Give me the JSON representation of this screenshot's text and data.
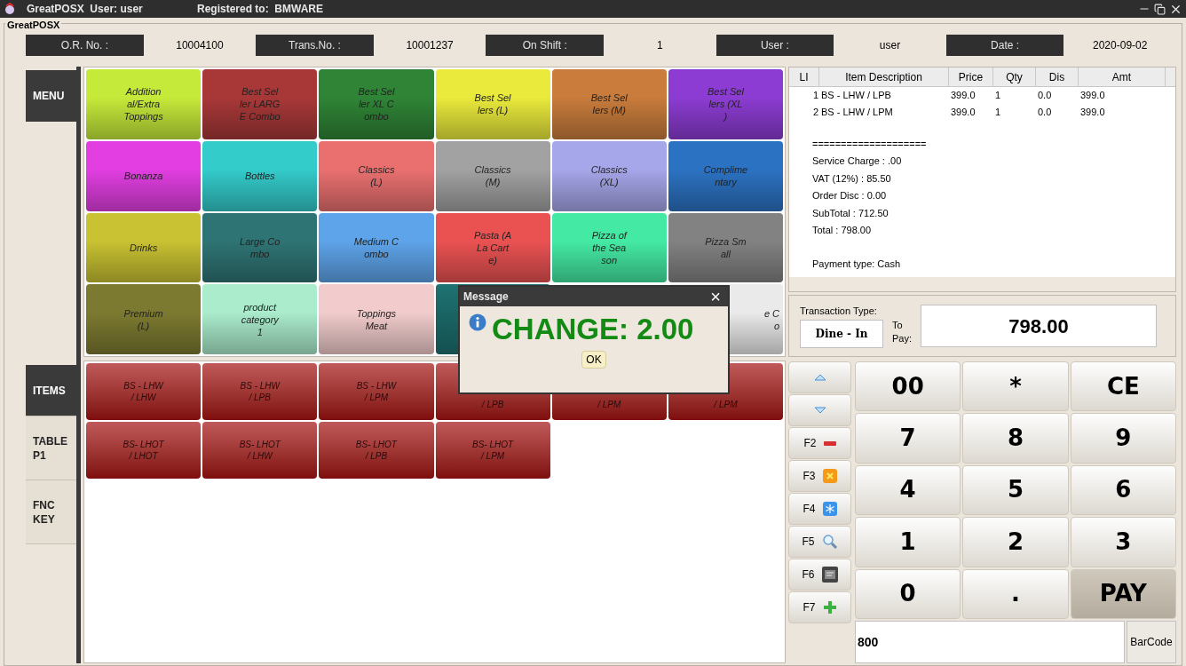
{
  "window": {
    "title": "GreatPOSX  User: user",
    "registered": "Registered to:  BMWARE",
    "group_label": "GreatPOSX"
  },
  "info_bar": [
    {
      "label": "O.R. No. :",
      "value": "10004100"
    },
    {
      "label": "Trans.No. :",
      "value": "10001237"
    },
    {
      "label": "On Shift :",
      "value": "1"
    },
    {
      "label": "User :",
      "value": "user"
    },
    {
      "label": "Date :",
      "value": "2020-09-02"
    }
  ],
  "menu_tab": {
    "label": "MENU",
    "selected": true
  },
  "item_tabs": [
    {
      "label": "ITEMS",
      "selected": true
    },
    {
      "label": "TABLE\nP1",
      "selected": false
    },
    {
      "label": "FNC\nKEY",
      "selected": false
    }
  ],
  "menu_tiles": [
    {
      "kind": "full",
      "color": "#c6ea3a",
      "lines": [
        "Addition",
        "al/Extra",
        "Toppings"
      ]
    },
    {
      "kind": "full",
      "color": "#a83838",
      "lines": [
        "Best Sel",
        "ler LARG",
        "E Combo"
      ]
    },
    {
      "kind": "full",
      "color": "#2f8436",
      "lines": [
        "Best Sel",
        "ler XL C",
        "ombo"
      ]
    },
    {
      "kind": "full",
      "color": "#eaea3c",
      "lines": [
        "Best Sel",
        "lers (L)"
      ]
    },
    {
      "kind": "full",
      "color": "#c97c3c",
      "lines": [
        "Best Sel",
        "lers (M)"
      ]
    },
    {
      "kind": "full",
      "color": "#8c3cd2",
      "lines": [
        "Best Sel",
        "lers (XL",
        ")"
      ]
    },
    {
      "kind": "full",
      "color": "#e23ee2",
      "lines": [
        "Bonanza"
      ]
    },
    {
      "kind": "full",
      "color": "#34cbcb",
      "lines": [
        "Bottles"
      ]
    },
    {
      "kind": "full",
      "color": "#ea7070",
      "lines": [
        "Classics",
        "(L)"
      ]
    },
    {
      "kind": "full",
      "color": "#a2a2a2",
      "lines": [
        "Classics",
        "(M)"
      ]
    },
    {
      "kind": "full",
      "color": "#a6a6ea",
      "lines": [
        "Classics",
        "(XL)"
      ]
    },
    {
      "kind": "full",
      "color": "#2c72c2",
      "lines": [
        "Complime",
        "ntary"
      ]
    },
    {
      "kind": "full",
      "color": "#c9c232",
      "lines": [
        "Drinks"
      ]
    },
    {
      "kind": "full",
      "color": "#2f7474",
      "lines": [
        "Large Co",
        "mbo"
      ]
    },
    {
      "kind": "full",
      "color": "#5ea4ea",
      "lines": [
        "Medium C",
        "ombo"
      ]
    },
    {
      "kind": "full",
      "color": "#ea5252",
      "lines": [
        "Pasta (A",
        "La Cart",
        "e)"
      ]
    },
    {
      "kind": "full",
      "color": "#44eaa4",
      "lines": [
        "Pizza of",
        "the Sea",
        "son"
      ]
    },
    {
      "kind": "full",
      "color": "#828282",
      "lines": [
        "Pizza Sm",
        "all"
      ]
    },
    {
      "kind": "full",
      "color": "#7c7a30",
      "lines": [
        "Premium",
        "(L)"
      ]
    },
    {
      "kind": "full",
      "color": "#aaeccc",
      "lines": [
        "product",
        "category",
        "1"
      ]
    },
    {
      "kind": "full",
      "color": "#f2cccc",
      "lines": [
        "Toppings",
        "Meat"
      ]
    },
    {
      "kind": "covered",
      "color": "#1e7272"
    },
    {
      "kind": "hidden"
    },
    {
      "kind": "right",
      "color": "#eaeaea",
      "lines": [
        "e C",
        "o"
      ]
    }
  ],
  "item_tiles": [
    {
      "kind": "full",
      "lines": [
        "BS - LHW",
        "/ LHW"
      ]
    },
    {
      "kind": "full",
      "lines": [
        "BS - LHW",
        "/ LPB"
      ]
    },
    {
      "kind": "full",
      "lines": [
        "BS - LHW",
        "/ LPM"
      ]
    },
    {
      "kind": "lower",
      "lines": [
        "/ LPB"
      ]
    },
    {
      "kind": "lower",
      "lines": [
        "/ LPM"
      ]
    },
    {
      "kind": "lower",
      "lines": [
        "/ LPM"
      ]
    },
    {
      "kind": "full",
      "lines": [
        "BS- LHOT",
        "/ LHOT"
      ]
    },
    {
      "kind": "full",
      "lines": [
        "BS- LHOT",
        "/ LHW"
      ]
    },
    {
      "kind": "full",
      "lines": [
        "BS- LHOT",
        "/ LPB"
      ]
    },
    {
      "kind": "full",
      "lines": [
        "BS- LHOT",
        "/ LPM"
      ]
    }
  ],
  "order_table": {
    "columns": [
      "LI",
      "Item Description",
      "Price",
      "Qty",
      "Dis",
      "Amt"
    ],
    "rows": [
      [
        "1",
        "BS - LHW / LPB",
        "399.0",
        "1",
        "0.0",
        "399.0"
      ],
      [
        "2",
        "BS - LHW / LPM",
        "399.0",
        "1",
        "0.0",
        "399.0"
      ]
    ],
    "summary": [
      "====================",
      "Service Charge : .00",
      "VAT (12%) : 85.50",
      "Order Disc : 0.00",
      "SubTotal : 712.50",
      "Total : 798.00"
    ],
    "payment": "Payment type: Cash"
  },
  "transaction": {
    "type_label": "Transaction Type:",
    "type": "Dine - In",
    "to_pay_label": "To\nPay:",
    "to_pay": "798.00"
  },
  "side_keys": [
    {
      "kind": "up"
    },
    {
      "kind": "down"
    },
    {
      "kind": "minus",
      "label": "F2"
    },
    {
      "kind": "cancel",
      "label": "F3"
    },
    {
      "kind": "snow",
      "label": "F4"
    },
    {
      "kind": "search",
      "label": "F5"
    },
    {
      "kind": "drawer",
      "label": "F6"
    },
    {
      "kind": "plus",
      "label": "F7"
    }
  ],
  "keypad": [
    {
      "label": "00",
      "kind": "key"
    },
    {
      "label": "*",
      "kind": "key"
    },
    {
      "label": "CE",
      "kind": "key"
    },
    {
      "label": "7",
      "kind": "key"
    },
    {
      "label": "8",
      "kind": "key"
    },
    {
      "label": "9",
      "kind": "key"
    },
    {
      "label": "4",
      "kind": "key"
    },
    {
      "label": "5",
      "kind": "key"
    },
    {
      "label": "6",
      "kind": "key"
    },
    {
      "label": "1",
      "kind": "key"
    },
    {
      "label": "2",
      "kind": "key"
    },
    {
      "label": "3",
      "kind": "key"
    },
    {
      "label": "0",
      "kind": "key"
    },
    {
      "label": ".",
      "kind": "key"
    },
    {
      "label": "PAY",
      "kind": "pay"
    }
  ],
  "entry": {
    "value": "800"
  },
  "barcode_button": "BarCode",
  "dialog": {
    "title": "Message",
    "message": "CHANGE: 2.00",
    "ok": "OK",
    "close": "×"
  }
}
